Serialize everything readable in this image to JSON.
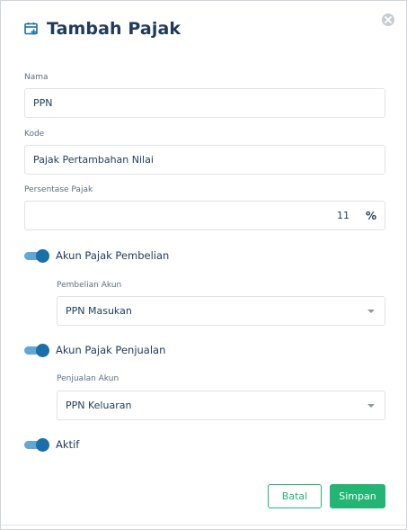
{
  "modal": {
    "title": "Tambah Pajak",
    "icon": "calendar-plus-icon",
    "close_icon": "close-icon"
  },
  "form": {
    "nama": {
      "label": "Nama",
      "value": "PPN"
    },
    "kode": {
      "label": "Kode",
      "value": "Pajak Pertambahan Nilai"
    },
    "persentase": {
      "label": "Persentase Pajak",
      "value": "11",
      "suffix": "%"
    },
    "akun_pembelian": {
      "toggle_label": "Akun Pajak Pembelian",
      "enabled": true,
      "select_label": "Pembelian Akun",
      "selected": "PPN Masukan"
    },
    "akun_penjualan": {
      "toggle_label": "Akun Pajak Penjualan",
      "enabled": true,
      "select_label": "Penjualan Akun",
      "selected": "PPN Keluaran"
    },
    "aktif": {
      "toggle_label": "Aktif",
      "enabled": true
    }
  },
  "actions": {
    "cancel_label": "Batal",
    "save_label": "Simpan"
  },
  "colors": {
    "primary_text": "#1f3a5a",
    "toggle_track": "#5ea7d6",
    "toggle_knob": "#1a6fa8",
    "accent_green": "#22b573"
  }
}
